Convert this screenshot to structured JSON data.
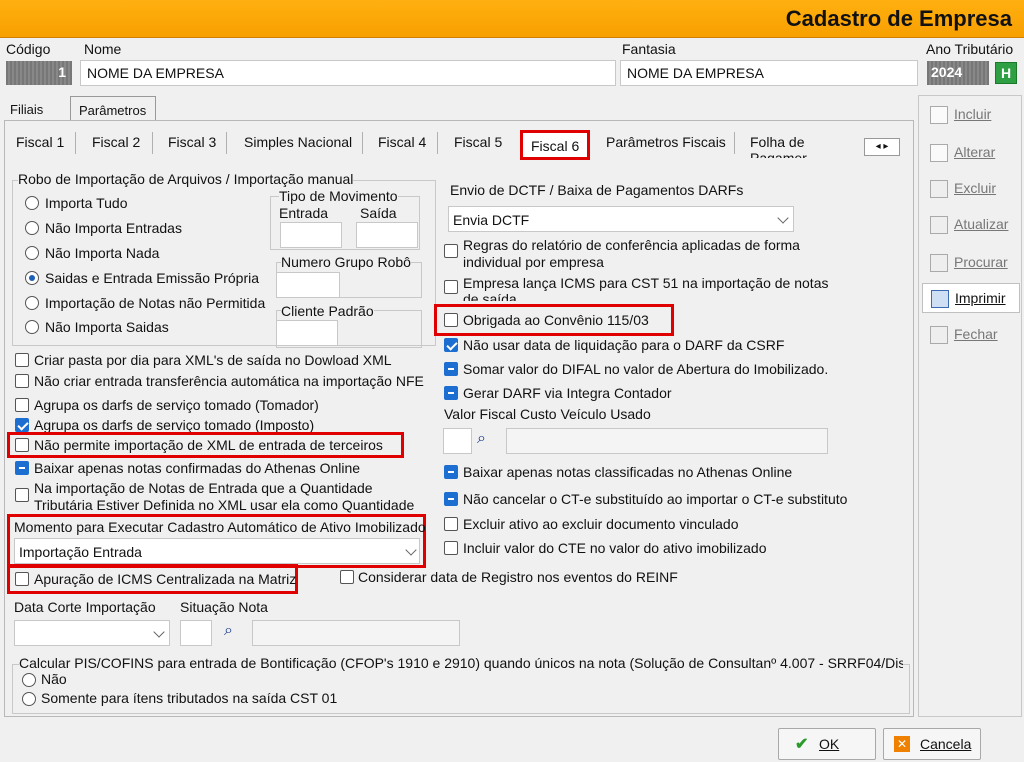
{
  "window": {
    "title": "Cadastro de Empresa"
  },
  "header": {
    "codigo_label": "Código",
    "codigo_value": "1",
    "nome_label": "Nome",
    "nome_value": "NOME DA EMPRESA",
    "fantasia_label": "Fantasia",
    "fantasia_value": "NOME DA EMPRESA",
    "ano_label": "Ano Tributário",
    "ano_value": "2024",
    "ano_btn": "H"
  },
  "tabs_top": [
    "Filiais",
    "Parâmetros"
  ],
  "tabs": [
    "Fiscal 1",
    "Fiscal 2",
    "Fiscal 3",
    "Simples Nacional",
    "Fiscal 4",
    "Fiscal 5",
    "Fiscal 6",
    "Parâmetros Fiscais",
    "Folha de Pagamer"
  ],
  "robo": {
    "title": "Robo de Importação de Arquivos /  Importação manual",
    "options": [
      "Importa Tudo",
      "Não Importa Entradas",
      "Não Importa Nada",
      "Saidas e Entrada Emissão Própria",
      "Importação de Notas não Permitida",
      "Não Importa Saidas"
    ],
    "selected": 3,
    "tipo_mov": "Tipo de Movimento",
    "entrada": "Entrada",
    "saida": "Saída",
    "numero_grupo": "Numero Grupo Robô",
    "cliente_padrao": "Cliente Padrão"
  },
  "left_checks": [
    "Criar pasta por dia para XML's de saída no Dowload XML",
    "Não criar entrada transferência automática na importação NFE",
    "Agrupa os darfs de serviço tomado (Tomador)",
    "Agrupa os darfs de serviço tomado (Imposto)",
    "Não permite importação de XML de entrada de terceiros",
    "Baixar apenas notas confirmadas do Athenas Online",
    "Na importação de Notas de Entrada que a Quantidade",
    "Tributária Estiver Definida no XML usar ela como Quantidade"
  ],
  "momento": {
    "label": "Momento para Executar Cadastro Automático de Ativo Imobilizado",
    "value": "Importação Entrada"
  },
  "apuracao": "Apuração de ICMS Centralizada na Matriz",
  "considerar": "Considerar data de Registro nos eventos do REINF",
  "data_corte": "Data Corte Importação",
  "situacao": "Situação Nota",
  "pis": {
    "label": "Calcular PIS/COFINS para entrada de Bontificação (CFOP's 1910 e 2910) quando únicos na nota (Solução de Consultanº 4.007 - SRRF04/Dis",
    "options": [
      "Não",
      "Somente para ítens tributados na saída CST 01"
    ]
  },
  "dctf": {
    "label": "Envio de DCTF / Baixa de Pagamentos DARFs",
    "value": "Envia DCTF"
  },
  "right_checks": [
    "Regras do relatório de  conferência aplicadas de forma",
    "individual por empresa",
    "Empresa lança ICMS para CST 51 na importação de notas",
    "de saída",
    "Obrigada ao Convênio 115/03",
    "Não usar data de liquidação para o DARF da CSRF",
    "Somar valor do DIFAL no valor de Abertura do Imobilizado.",
    "Gerar DARF via Integra Contador"
  ],
  "valor_fiscal": "Valor Fiscal Custo Veículo Usado",
  "right_checks2": [
    "Baixar apenas notas classificadas no Athenas Online",
    "Não cancelar o CT-e substituído ao importar o CT-e substituto",
    "Excluir ativo ao excluir documento vinculado",
    "Incluir valor do CTE no valor do ativo imobilizado"
  ],
  "side": [
    "Incluir",
    "Alterar",
    "Excluir",
    "Atualizar",
    "Procurar",
    "Imprimir",
    "Fechar"
  ],
  "footer": {
    "ok": "OK",
    "cancel": "Cancela"
  },
  "colors": {
    "accent": "#f7a000",
    "highlight": "#e00000",
    "check": "#1c6fd0"
  }
}
